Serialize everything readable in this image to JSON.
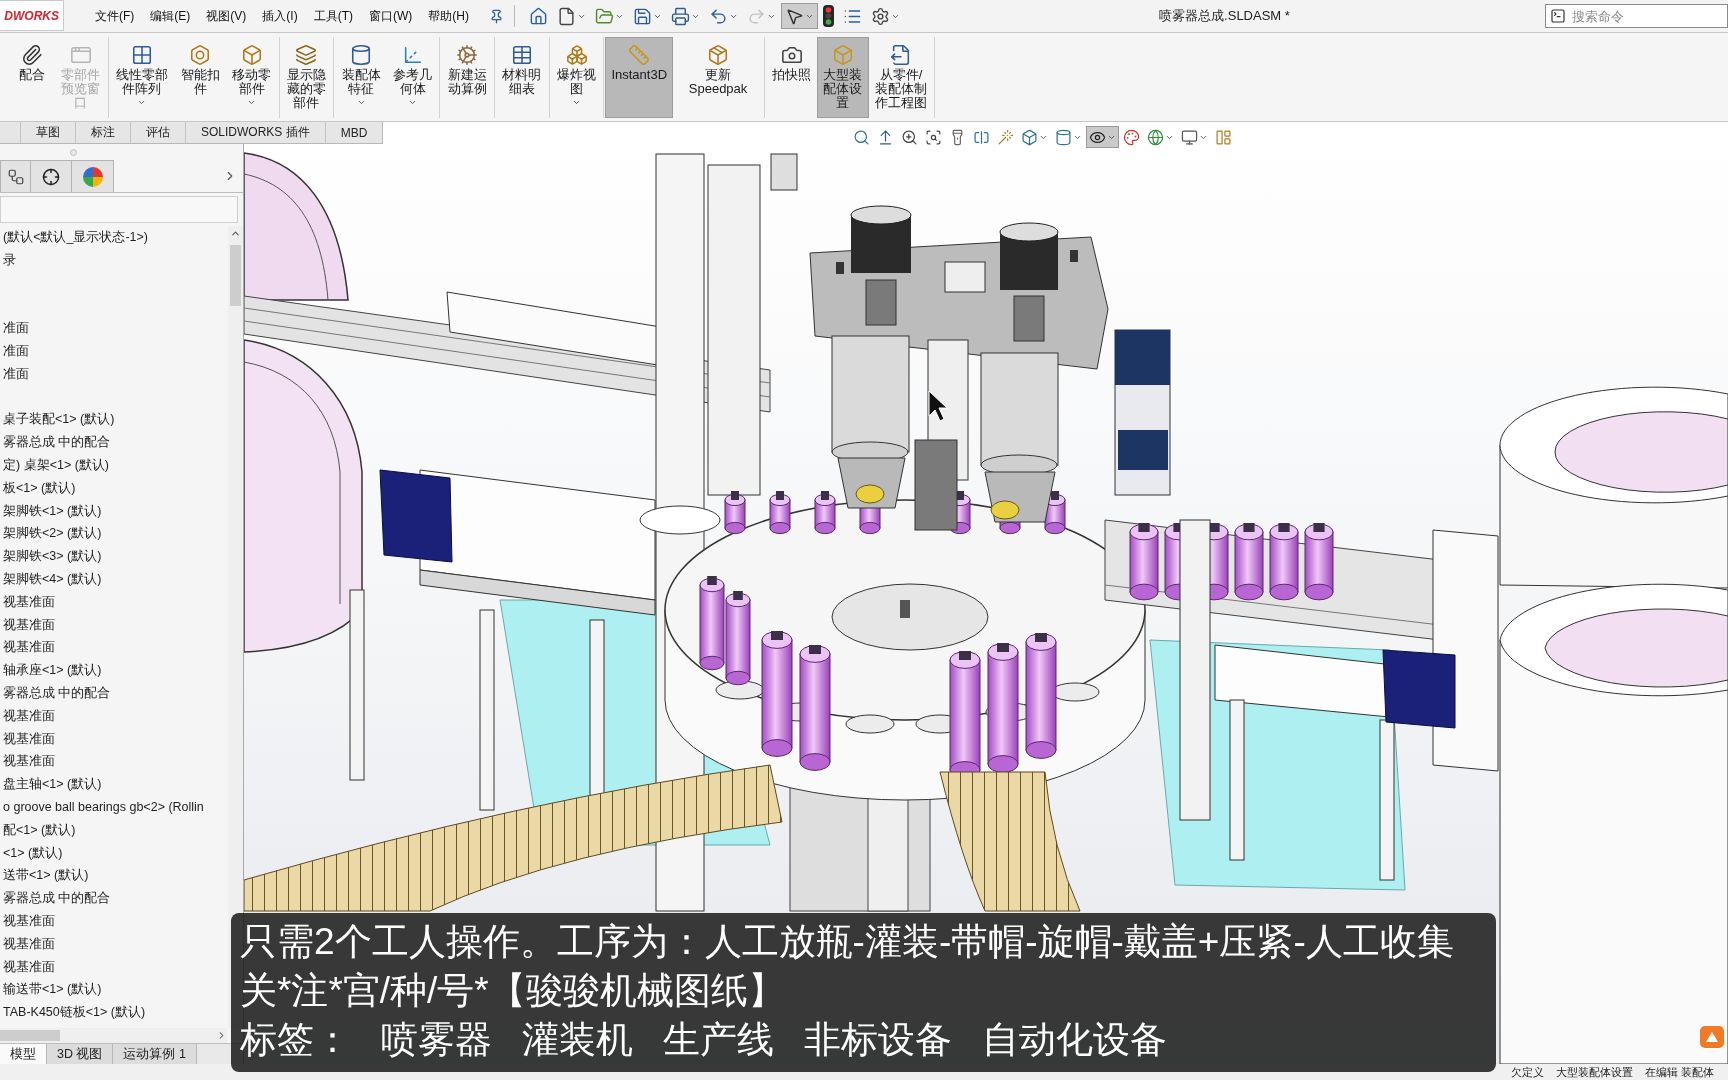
{
  "title_bar": {
    "logo": "DWORKS",
    "menu": [
      "文件(F)",
      "编辑(E)",
      "视图(V)",
      "插入(I)",
      "工具(T)",
      "窗口(W)",
      "帮助(H)"
    ],
    "quick_access": [
      {
        "kind": "home",
        "dropdown": false,
        "disabled": false,
        "on": false
      },
      {
        "kind": "new",
        "dropdown": true,
        "disabled": false,
        "on": false
      },
      {
        "kind": "open",
        "dropdown": true,
        "disabled": false,
        "on": false
      },
      {
        "kind": "save",
        "dropdown": true,
        "disabled": false,
        "on": false
      },
      {
        "kind": "print",
        "dropdown": true,
        "disabled": false,
        "on": false
      },
      {
        "kind": "undo",
        "dropdown": true,
        "disabled": false,
        "on": false
      },
      {
        "kind": "redo",
        "dropdown": true,
        "disabled": true,
        "on": false
      },
      {
        "kind": "select",
        "dropdown": true,
        "disabled": false,
        "on": true
      },
      {
        "kind": "rebuild",
        "dropdown": false,
        "disabled": false,
        "on": false
      },
      {
        "kind": "file_properties",
        "dropdown": false,
        "disabled": false,
        "on": false
      },
      {
        "kind": "options",
        "dropdown": true,
        "disabled": false,
        "on": false
      }
    ],
    "title": "喷雾器总成.SLDASM *",
    "search": {
      "placeholder": "搜索命令"
    }
  },
  "ribbon": [
    {
      "buttons": [
        {
          "kind": "mate",
          "label": "配合",
          "dropdown": false,
          "disabled": false,
          "on": false
        },
        {
          "kind": "component_preview",
          "label": "零部件预览窗口",
          "dropdown": false,
          "disabled": true,
          "on": false
        }
      ]
    },
    {
      "buttons": [
        {
          "kind": "linear_pattern",
          "label": "线性零部件阵列",
          "dropdown": true,
          "disabled": false,
          "on": false
        },
        {
          "kind": "smart_fasteners",
          "label": "智能扣件",
          "dropdown": false,
          "disabled": false,
          "on": false
        },
        {
          "kind": "move_component",
          "label": "移动零部件",
          "dropdown": true,
          "disabled": false,
          "on": false
        }
      ]
    },
    {
      "buttons": [
        {
          "kind": "show_hidden",
          "label": "显示隐藏的零部件",
          "dropdown": false,
          "disabled": false,
          "on": false
        }
      ]
    },
    {
      "buttons": [
        {
          "kind": "assembly_features",
          "label": "装配体特征",
          "dropdown": true,
          "disabled": false,
          "on": false
        },
        {
          "kind": "reference_geometry",
          "label": "参考几何体",
          "dropdown": true,
          "disabled": false,
          "on": false
        }
      ]
    },
    {
      "buttons": [
        {
          "kind": "motion_study",
          "label": "新建运动算例",
          "dropdown": false,
          "disabled": false,
          "on": false
        }
      ]
    },
    {
      "buttons": [
        {
          "kind": "bill_of_materials",
          "label": "材料明细表",
          "dropdown": false,
          "disabled": false,
          "on": false
        }
      ]
    },
    {
      "buttons": [
        {
          "kind": "exploded_view",
          "label": "爆炸视图",
          "dropdown": true,
          "disabled": false,
          "on": false
        }
      ]
    },
    {
      "buttons": [
        {
          "kind": "instant3d",
          "label": "Instant3D",
          "dropdown": false,
          "disabled": false,
          "on": true
        },
        {
          "kind": "speedpak",
          "label": "更新Speedpak",
          "dropdown": false,
          "disabled": false,
          "on": false
        }
      ]
    },
    {
      "buttons": [
        {
          "kind": "snapshot",
          "label": "拍快照",
          "dropdown": false,
          "disabled": false,
          "on": false
        },
        {
          "kind": "large_assembly",
          "label": "大型装配体设置",
          "dropdown": false,
          "disabled": false,
          "on": true
        },
        {
          "kind": "make_drawing",
          "label": "从零件/装配体制作工程图",
          "dropdown": false,
          "disabled": false,
          "on": false
        }
      ]
    }
  ],
  "command_tabs": [
    {
      "label": "草图",
      "selected": false
    },
    {
      "label": "标注",
      "selected": false
    },
    {
      "label": "评估",
      "selected": false
    },
    {
      "label": "SOLIDWORKS 插件",
      "selected": false
    },
    {
      "label": "MBD",
      "selected": false
    }
  ],
  "heads_up_toolbar": [
    {
      "kind": "zoom_fit",
      "dropdown": false,
      "on": false
    },
    {
      "kind": "normal_to",
      "dropdown": false,
      "on": false
    },
    {
      "kind": "zoom_area",
      "dropdown": false,
      "on": false
    },
    {
      "kind": "zoom_previous",
      "dropdown": false,
      "on": false
    },
    {
      "kind": "previous_view",
      "dropdown": false,
      "on": false
    },
    {
      "kind": "section_view",
      "dropdown": false,
      "on": false
    },
    {
      "kind": "annotations",
      "dropdown": false,
      "on": false
    },
    {
      "kind": "view_orientation",
      "dropdown": true,
      "on": false
    },
    {
      "kind": "display_style",
      "dropdown": true,
      "on": false
    },
    {
      "kind": "hide_show",
      "dropdown": true,
      "on": true
    },
    {
      "kind": "appearance",
      "dropdown": false,
      "on": false
    },
    {
      "kind": "scene",
      "dropdown": true,
      "on": false
    },
    {
      "kind": "view_settings",
      "dropdown": true,
      "on": false
    },
    {
      "kind": "viewport_layout",
      "dropdown": false,
      "on": false
    }
  ],
  "feature_panel": {
    "tabs": [
      {
        "kind": "configuration"
      },
      {
        "kind": "dimxpert"
      },
      {
        "kind": "display"
      }
    ],
    "tree": [
      {
        "kind": "item",
        "text": "(默认<默认_显示状态-1>)"
      },
      {
        "kind": "item",
        "text": "录"
      },
      {
        "kind": "blank"
      },
      {
        "kind": "blank"
      },
      {
        "kind": "item",
        "text": "准面"
      },
      {
        "kind": "item",
        "text": "准面"
      },
      {
        "kind": "item",
        "text": "准面"
      },
      {
        "kind": "blank"
      },
      {
        "kind": "item",
        "text": "桌子装配<1> (默认)"
      },
      {
        "kind": "item",
        "text": "雾器总成 中的配合"
      },
      {
        "kind": "item",
        "text": "定) 桌架<1> (默认)"
      },
      {
        "kind": "item",
        "text": "板<1> (默认)"
      },
      {
        "kind": "item",
        "text": "架脚铁<1> (默认)"
      },
      {
        "kind": "item",
        "text": "架脚铁<2> (默认)"
      },
      {
        "kind": "item",
        "text": "架脚铁<3> (默认)"
      },
      {
        "kind": "item",
        "text": "架脚铁<4> (默认)"
      },
      {
        "kind": "item",
        "text": "视基准面"
      },
      {
        "kind": "item",
        "text": "视基准面"
      },
      {
        "kind": "item",
        "text": "视基准面"
      },
      {
        "kind": "item",
        "text": "轴承座<1> (默认)"
      },
      {
        "kind": "item",
        "text": "雾器总成 中的配合"
      },
      {
        "kind": "item",
        "text": "视基准面"
      },
      {
        "kind": "item",
        "text": "视基准面"
      },
      {
        "kind": "item",
        "text": "视基准面"
      },
      {
        "kind": "item",
        "text": "盘主轴<1> (默认)"
      },
      {
        "kind": "item",
        "text": "o groove ball bearings gb<2> (Rollin"
      },
      {
        "kind": "item",
        "text": "配<1> (默认)"
      },
      {
        "kind": "item",
        "text": "<1> (默认)"
      },
      {
        "kind": "item",
        "text": "送带<1> (默认)"
      },
      {
        "kind": "item",
        "text": "雾器总成 中的配合"
      },
      {
        "kind": "item",
        "text": "视基准面"
      },
      {
        "kind": "item",
        "text": "视基准面"
      },
      {
        "kind": "item",
        "text": "视基准面"
      },
      {
        "kind": "item",
        "text": "输送带<1> (默认)"
      },
      {
        "kind": "item",
        "text": "TAB-K450链板<1> (默认)"
      }
    ],
    "bottom_tabs": [
      {
        "label": "模型",
        "selected": true
      },
      {
        "label": "3D 视图",
        "selected": false
      },
      {
        "label": "运动算例 1",
        "selected": false
      }
    ]
  },
  "caption": {
    "lines": [
      "只需2个工人操作。工序为：人工放瓶-灌装-带帽-旋帽-戴盖+压紧-人工收集",
      "关*注*宫/种/号*【骏骏机械图纸】"
    ],
    "tags_label": "标签：",
    "tags": [
      "喷雾器",
      "灌装机",
      "生产线",
      "非标设备",
      "自动化设备"
    ]
  },
  "status_bar": [
    "欠定义",
    "大型装配体设置",
    "在编辑 装配体"
  ]
}
